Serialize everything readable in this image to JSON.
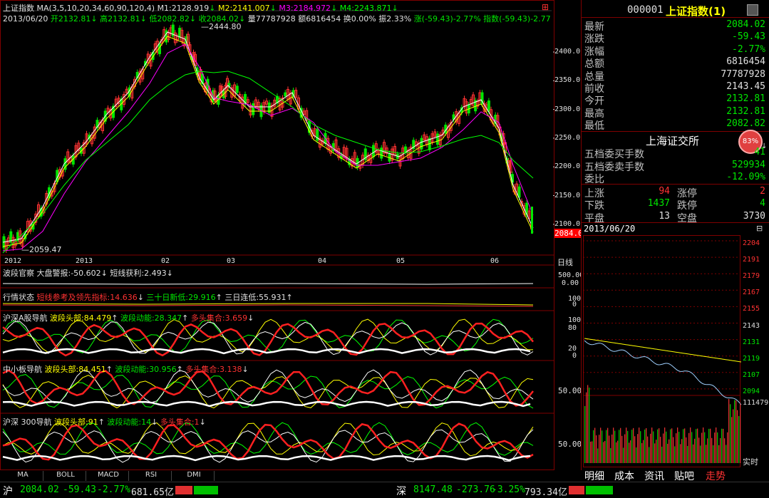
{
  "header": {
    "index_name": "上证指数",
    "ma_text": "MA(3,5,10,20,34,60,90,120,4)",
    "m1": "M1:2128.919",
    "m2": "M2:2141.007",
    "m3": "M3:2184.972",
    "m4": "M4:2243.871",
    "info_date": "2013/06/20",
    "open": "开2132.81",
    "high": "高2132.81",
    "low": "低2082.82",
    "close": "收2084.02",
    "volume": "量77787928",
    "amount": "额6816454",
    "turnover": "换0.00%",
    "amplitude": "振2.33%",
    "change": "涨(-59.43)-2.77%",
    "index_change": "指数(-59.43)-2.77"
  },
  "main_chart": {
    "high_label": "2444.80",
    "low_label": "2059.47",
    "last_price_label": "2084.0",
    "y_ticks": [
      "2400.0",
      "2350.0",
      "2300.0",
      "2250.0",
      "2200.0",
      "2150.0",
      "2100.0"
    ],
    "x_ticks": [
      "2012",
      "2013",
      "02",
      "03",
      "04",
      "05",
      "06"
    ],
    "period_label": "日线"
  },
  "indicator_panels": {
    "p1": {
      "name": "波段官察",
      "t1": "大盘警报:-50.602",
      "t2": "短线获利:2.493",
      "ticks": [
        "500.00",
        "0.00"
      ]
    },
    "p2": {
      "name": "行情状态",
      "t1": "短线参考及领先指标:14.636",
      "t2": "三十日新低:29.916",
      "t3": "三日连低:55.931",
      "ticks": [
        "100",
        "0"
      ]
    },
    "p3": {
      "name": "沪深A股导航",
      "t1": "波段头部:84.479",
      "t2": "波段动能:28.347",
      "t3": "多头集合:3.659",
      "ticks": [
        "80",
        "100",
        "20",
        "0"
      ]
    },
    "p4": {
      "name": "中小板导航",
      "t1": "波段头部:84.451",
      "t2": "波段动能:30.956",
      "t3": "多头集合:3.138",
      "ticks": [
        "50.00"
      ]
    },
    "p5": {
      "name": "沪深 300导航",
      "t1": "波段头部:91",
      "t2": "波段动能:14",
      "t3": "多头集合:1",
      "ticks": [
        "50.00"
      ]
    }
  },
  "indicator_tabs": [
    "MA",
    "BOLL",
    "MACD",
    "RSI",
    "DMI"
  ],
  "quote": {
    "code": "000001",
    "name": "上证指数(1)",
    "rows": [
      {
        "k": "最新",
        "v": "2084.02",
        "c": "green"
      },
      {
        "k": "涨跌",
        "v": "-59.43",
        "c": "green"
      },
      {
        "k": "涨幅",
        "v": "-2.77%",
        "c": "green"
      },
      {
        "k": "总额",
        "v": "6816454",
        "c": "white"
      },
      {
        "k": "总量",
        "v": "77787928",
        "c": "white"
      },
      {
        "k": "前收",
        "v": "2143.45",
        "c": "white"
      },
      {
        "k": "今开",
        "v": "2132.81",
        "c": "green"
      },
      {
        "k": "最高",
        "v": "2132.81",
        "c": "green"
      },
      {
        "k": "最低",
        "v": "2082.82",
        "c": "green"
      }
    ],
    "exchange": "上海证交所",
    "badge": "83%",
    "rows2": [
      {
        "k": "五档委买手数",
        "v": "41",
        "c": "green"
      },
      {
        "k": "五档委卖手数",
        "v": "529934",
        "c": "green"
      },
      {
        "k": "委比",
        "v": "-12.09%",
        "c": "green"
      }
    ],
    "stats": [
      {
        "k1": "上涨",
        "v1": "94",
        "k2": "涨停",
        "v2": "2",
        "c1": "red",
        "c2": "red"
      },
      {
        "k1": "下跌",
        "v1": "1437",
        "k2": "跌停",
        "v2": "4",
        "c1": "green",
        "c2": "green"
      },
      {
        "k1": "平盘",
        "v1": "13",
        "k2": "空盘",
        "v2": "3730",
        "c1": "white",
        "c2": "white"
      }
    ],
    "mini_date": "2013/06/20",
    "mini_ticks": [
      "2204",
      "2191",
      "2179",
      "2167",
      "2155",
      "2143",
      "2131",
      "2119",
      "2107",
      "2094"
    ],
    "mini_vol": "111479",
    "realtime_label": "实时"
  },
  "right_tabs": [
    "明细",
    "成本",
    "资讯",
    "贴吧",
    "走势"
  ],
  "bottom": {
    "sh_label": "沪",
    "sh_price": "2084.02",
    "sh_change": "-59.43",
    "sh_pct": "-2.77%",
    "sh_amount": "681.65亿",
    "sz_label": "深",
    "sz_price": "8147.48",
    "sz_change": "-273.76",
    "sz_pct": "-3.25%",
    "sz_amount": "793.34亿"
  },
  "colors": {
    "up": "#ff3232",
    "down": "#00e600",
    "ma1": "#ffffff",
    "ma2": "#ffff00",
    "ma3": "#ff00ff",
    "ma4": "#00ff00",
    "grid": "#7f0000"
  }
}
